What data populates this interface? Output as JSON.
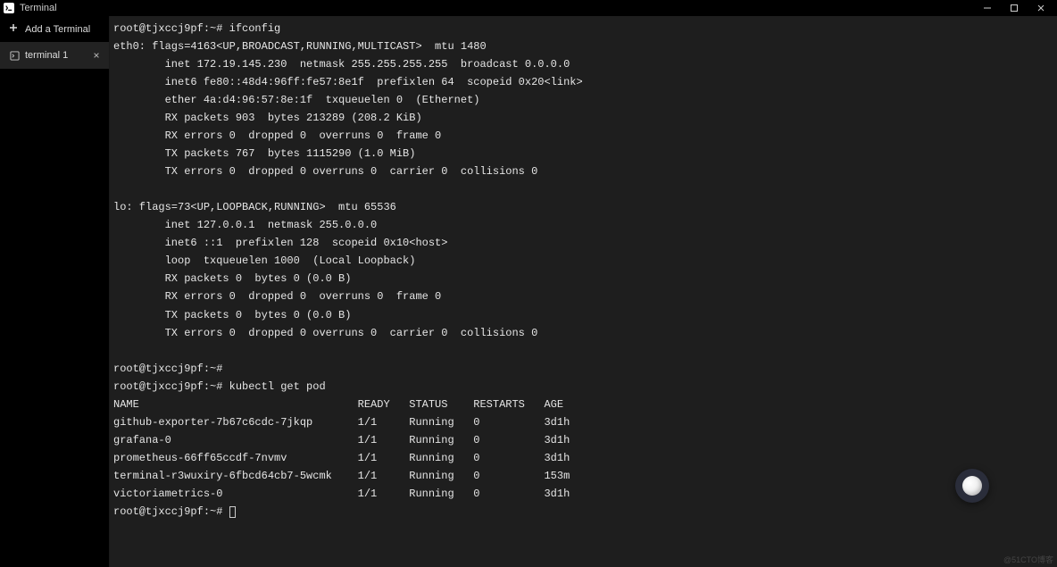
{
  "titlebar": {
    "title": "Terminal"
  },
  "sidebar": {
    "add_label": "Add a Terminal",
    "tabs": [
      {
        "label": "terminal 1"
      }
    ]
  },
  "terminal": {
    "lines": [
      "root@tjxccj9pf:~# ifconfig",
      "eth0: flags=4163<UP,BROADCAST,RUNNING,MULTICAST>  mtu 1480",
      "        inet 172.19.145.230  netmask 255.255.255.255  broadcast 0.0.0.0",
      "        inet6 fe80::48d4:96ff:fe57:8e1f  prefixlen 64  scopeid 0x20<link>",
      "        ether 4a:d4:96:57:8e:1f  txqueuelen 0  (Ethernet)",
      "        RX packets 903  bytes 213289 (208.2 KiB)",
      "        RX errors 0  dropped 0  overruns 0  frame 0",
      "        TX packets 767  bytes 1115290 (1.0 MiB)",
      "        TX errors 0  dropped 0 overruns 0  carrier 0  collisions 0",
      "",
      "lo: flags=73<UP,LOOPBACK,RUNNING>  mtu 65536",
      "        inet 127.0.0.1  netmask 255.0.0.0",
      "        inet6 ::1  prefixlen 128  scopeid 0x10<host>",
      "        loop  txqueuelen 1000  (Local Loopback)",
      "        RX packets 0  bytes 0 (0.0 B)",
      "        RX errors 0  dropped 0  overruns 0  frame 0",
      "        TX packets 0  bytes 0 (0.0 B)",
      "        TX errors 0  dropped 0 overruns 0  carrier 0  collisions 0",
      "",
      "root@tjxccj9pf:~# ",
      "root@tjxccj9pf:~# kubectl get pod",
      "NAME                                  READY   STATUS    RESTARTS   AGE",
      "github-exporter-7b67c6cdc-7jkqp       1/1     Running   0          3d1h",
      "grafana-0                             1/1     Running   0          3d1h",
      "prometheus-66ff65ccdf-7nvmv           1/1     Running   0          3d1h",
      "terminal-r3wuxiry-6fbcd64cb7-5wcmk    1/1     Running   0          153m",
      "victoriametrics-0                     1/1     Running   0          3d1h"
    ],
    "prompt": "root@tjxccj9pf:~# "
  },
  "watermark": "@51CTO博客"
}
